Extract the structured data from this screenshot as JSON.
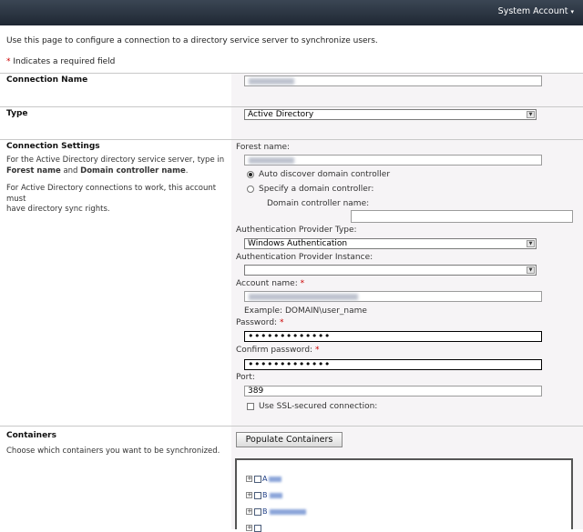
{
  "header": {
    "account_label": "System Account",
    "caret": "▾"
  },
  "intro_text": "Use this page to configure a connection to a directory service server to synchronize users.",
  "required_note": {
    "star": "*",
    "text": " Indicates a required field"
  },
  "connection_name": {
    "title": "Connection Name",
    "value": "apac.bpww.org"
  },
  "type": {
    "title": "Type",
    "selected": "Active Directory"
  },
  "connection_settings": {
    "title": "Connection Settings",
    "desc1_a": "For the Active Directory directory service server, type in",
    "desc1_b1": "Forest name",
    "desc1_b2": " and ",
    "desc1_b3": "Domain controller name",
    "desc1_b4": ".",
    "desc2_a": "For Active Directory connections to work, this account must",
    "desc2_b": "have directory sync rights.",
    "forest_label": "Forest name:",
    "forest_value": "apac.bpww.org",
    "radio_auto": "Auto discover domain controller",
    "radio_specify": "Specify a domain controller:",
    "dc_label": "Domain controller name:",
    "auth_type_label": "Authentication Provider Type:",
    "auth_type_selected": "Windows Authentication",
    "auth_instance_label": "Authentication Provider Instance:",
    "auth_instance_selected": "",
    "account_label": "Account name:",
    "account_value": "BPWW\\MOSSADMIN",
    "account_example": "Example: DOMAIN\\user_name",
    "password_label": "Password:",
    "password_value": "•••••••••••••",
    "confirm_label": "Confirm password:",
    "confirm_value": "•••••••••••••",
    "port_label": "Port:",
    "port_value": "389",
    "ssl_label": "Use SSL-secured connection:"
  },
  "containers": {
    "title": "Containers",
    "desc": "Choose which containers you want to be synchronized.",
    "populate_button": "Populate Containers",
    "tree": [
      {
        "letter": "A",
        "name": "PAC"
      },
      {
        "letter": "B",
        "name": "PWW"
      },
      {
        "letter": "B",
        "name": "BGRPPORT"
      }
    ]
  }
}
